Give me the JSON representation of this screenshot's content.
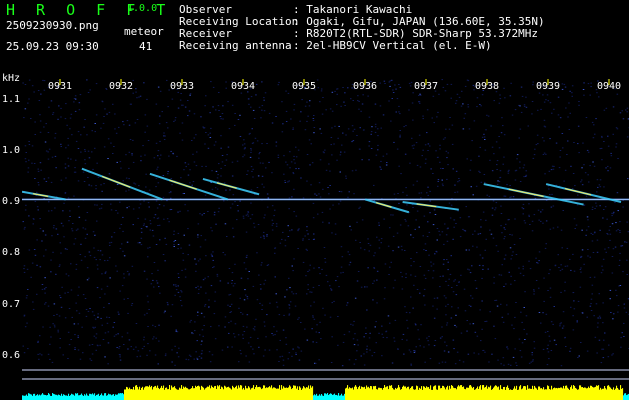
{
  "header": {
    "app_name": "H R O F F T",
    "app_version": "1.0.0",
    "file_name": "2509230930.png",
    "datetime": "25.09.23 09:30",
    "meteor_label": "meteor",
    "meteor_count": "41",
    "info": [
      {
        "label": "Observer",
        "value": ": Takanori Kawachi"
      },
      {
        "label": "Receiving Location",
        "value": ": Ogaki, Gifu, JAPAN (136.60E, 35.35N)"
      },
      {
        "label": "Receiver",
        "value": ": R820T2(RTL-SDR) SDR-Sharp 53.372MHz"
      },
      {
        "label": "Receiving antenna",
        "value": ": 2el-HB9CV Vertical (el. E-W)"
      }
    ]
  },
  "axis": {
    "unit": "kHz",
    "y_ticks": [
      "1.1",
      "1.0",
      "0.9",
      "0.8",
      "0.7",
      "0.6"
    ],
    "y_range": [
      0.58,
      1.14
    ],
    "x_ticks": [
      "0931",
      "0932",
      "0933",
      "0934",
      "0935",
      "0936",
      "0937",
      "0938",
      "0939",
      "0940"
    ]
  },
  "colors": {
    "background": "#000000",
    "header_green": "#19ff19",
    "noise": "#101a55",
    "carrier": "#6fa8ff",
    "tick_yellow": "#ffff00",
    "power_yellow": "#ffff00",
    "power_cyan": "#00ffff"
  },
  "carrier_khz": 0.905,
  "meteor_traces": [
    {
      "t0": 0.96,
      "f0": 0.965,
      "t1": 2.25,
      "f1": 0.905
    },
    {
      "t0": 2.05,
      "f0": 0.955,
      "t1": 3.3,
      "f1": 0.905
    },
    {
      "t0": 2.9,
      "f0": 0.945,
      "t1": 3.8,
      "f1": 0.915
    },
    {
      "t0": 5.5,
      "f0": 0.905,
      "t1": 6.2,
      "f1": 0.88
    },
    {
      "t0": 6.1,
      "f0": 0.9,
      "t1": 7.0,
      "f1": 0.885
    },
    {
      "t0": 7.4,
      "f0": 0.935,
      "t1": 9.0,
      "f1": 0.895
    },
    {
      "t0": 8.4,
      "f0": 0.935,
      "t1": 9.6,
      "f1": 0.9
    },
    {
      "t0": 0.0,
      "f0": 0.92,
      "t1": 0.7,
      "f1": 0.905
    }
  ]
}
